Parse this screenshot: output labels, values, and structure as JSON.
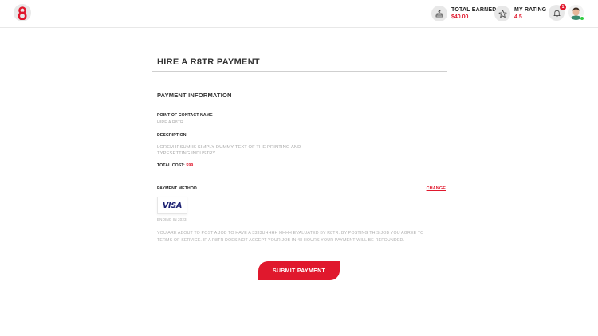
{
  "header": {
    "total_earned_label": "TOTAL EARNED",
    "total_earned_value": "$40.00",
    "rating_label": "MY RATING",
    "rating_value": "4.5",
    "notification_count": "1"
  },
  "page": {
    "title": "HIRE A R8TR PAYMENT"
  },
  "payment_info": {
    "section_title": "PAYMENT INFORMATION",
    "contact_label": "POINT OF CONTACT NAME",
    "contact_value": "HIRE A R8TR",
    "description_label": "DESCRIPTION:",
    "description_text": "LOREM IPSUM IS SIMPLY DUMMY TEXT OF THE PRINTING AND TYPESETTING INDUSTRY.",
    "total_label": "TOTAL COST:",
    "total_value": "$99"
  },
  "payment_method": {
    "label": "PAYMENT METHOD",
    "change_label": "CHANGE",
    "card_brand": "VISA",
    "ending_text": "ENDING IN 2023"
  },
  "notice_text": "YOU ARE ABOUT TO POST A JOB TO HAVE A 3333UHHHH HHHH EVALUATED BY R8TR. BY POSTING THIS JOB YOU AGREE TO TERMS OF SERVICE. IF A R8TR DOES NOT ACCEPT YOUR JOB IN 48 HOURS YOUR PAYMENT WILL BE REFOUNDED.",
  "submit_label": "SUBMIT PAYMENT",
  "colors": {
    "accent": "#e0182d",
    "online": "#2ecc40",
    "visa": "#1a1f71"
  }
}
